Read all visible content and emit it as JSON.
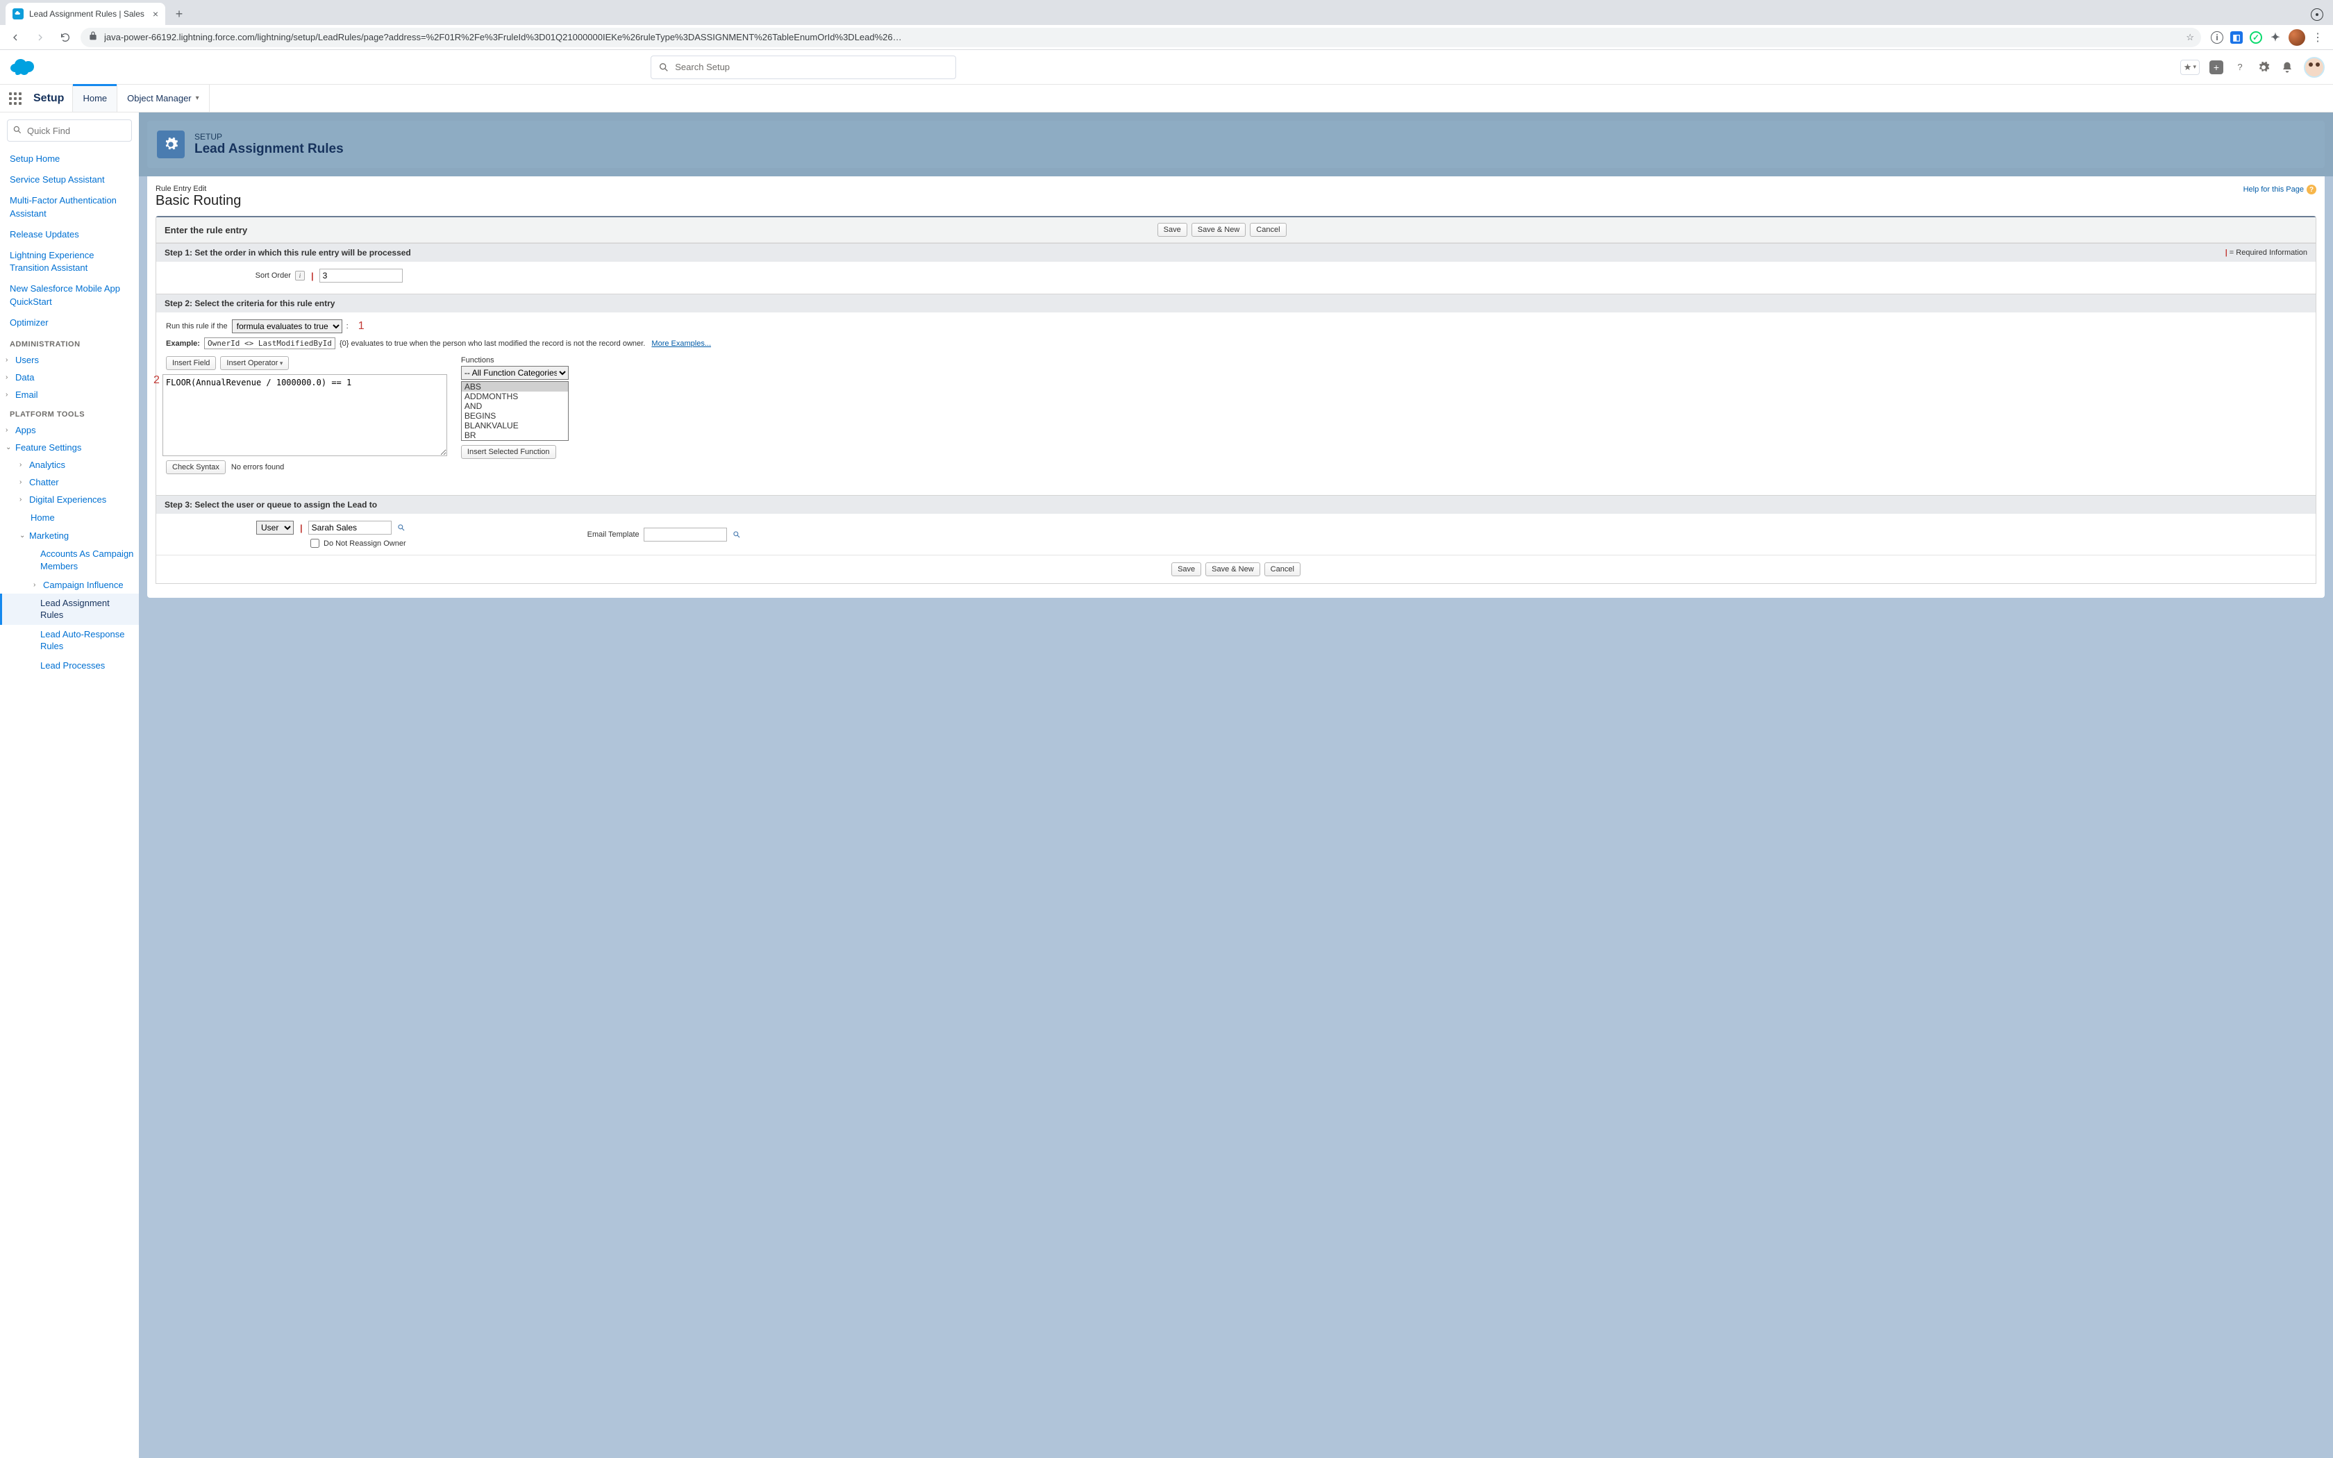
{
  "browser": {
    "tab_title": "Lead Assignment Rules | Sales",
    "url": "java-power-66192.lightning.force.com/lightning/setup/LeadRules/page?address=%2F01R%2Fe%3FruleId%3D01Q21000000IEKe%26ruleType%3DASSIGNMENT%26TableEnumOrId%3DLead%26…"
  },
  "header": {
    "search_placeholder": "Search Setup"
  },
  "nav": {
    "app_label": "Setup",
    "home": "Home",
    "object_manager": "Object Manager"
  },
  "sidebar": {
    "quick_find_placeholder": "Quick Find",
    "links": [
      "Setup Home",
      "Service Setup Assistant",
      "Multi-Factor Authentication Assistant",
      "Release Updates",
      "Lightning Experience Transition Assistant",
      "New Salesforce Mobile App QuickStart",
      "Optimizer"
    ],
    "section_admin": "ADMINISTRATION",
    "admin_items": [
      "Users",
      "Data",
      "Email"
    ],
    "section_platform": "PLATFORM TOOLS",
    "platform_apps": "Apps",
    "feature_settings": "Feature Settings",
    "fs_children": [
      "Analytics",
      "Chatter",
      "Digital Experiences"
    ],
    "fs_home": "Home",
    "marketing": "Marketing",
    "marketing_children": {
      "accounts_campaign": "Accounts As Campaign Members",
      "campaign_influence": "Campaign Influence",
      "lead_assignment": "Lead Assignment Rules",
      "lead_auto": "Lead Auto-Response Rules",
      "lead_processes": "Lead Processes"
    }
  },
  "page_header": {
    "eyebrow": "SETUP",
    "title": "Lead Assignment Rules"
  },
  "form": {
    "crumb": "Rule Entry Edit",
    "title": "Basic Routing",
    "help": "Help for this Page",
    "section_title": "Enter the rule entry",
    "save": "Save",
    "save_new": "Save & New",
    "cancel": "Cancel",
    "step1": {
      "title": "Step 1: Set the order in which this rule entry will be processed",
      "required_hint": "= Required Information",
      "sort_order_label": "Sort Order",
      "sort_order_value": "3"
    },
    "step2": {
      "title": "Step 2: Select the criteria for this rule entry",
      "run_label": "Run this rule if the",
      "run_select": "formula evaluates to true",
      "annot1": "1",
      "example_label": "Example:",
      "example_code": "OwnerId <> LastModifiedById",
      "example_desc": "{0} evaluates to true when the person who last modified the record is not the record owner.",
      "more_examples": "More Examples...",
      "insert_field": "Insert Field",
      "insert_operator": "Insert Operator",
      "annot2": "2",
      "formula": "FLOOR(AnnualRevenue / 1000000.0) == 1",
      "check_syntax": "Check Syntax",
      "syntax_msg": "No errors found",
      "functions_label": "Functions",
      "fn_category": "-- All Function Categories --",
      "fn_list": [
        "ABS",
        "ADDMONTHS",
        "AND",
        "BEGINS",
        "BLANKVALUE",
        "BR"
      ],
      "insert_fn": "Insert Selected Function"
    },
    "step3": {
      "title": "Step 3: Select the user or queue to assign the Lead to",
      "assignee_type": "User",
      "assignee_value": "Sarah Sales",
      "reassign_label": "Do Not Reassign Owner",
      "email_template_label": "Email Template"
    }
  }
}
